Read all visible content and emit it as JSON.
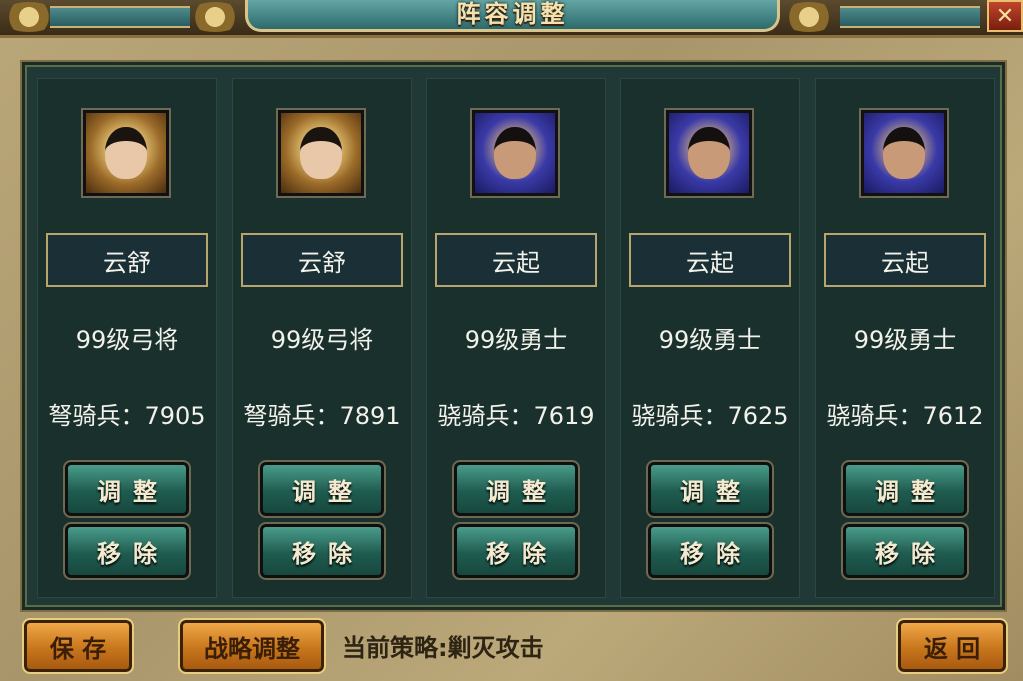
{
  "header": {
    "title": "阵容调整",
    "close_label": "✕"
  },
  "members": [
    {
      "portrait": "female-general-portrait",
      "name": "云舒",
      "level_class": "99级弓将",
      "troops": "弩骑兵：7905"
    },
    {
      "portrait": "female-general-portrait",
      "name": "云舒",
      "level_class": "99级弓将",
      "troops": "弩骑兵：7891"
    },
    {
      "portrait": "male-warrior-portrait",
      "name": "云起",
      "level_class": "99级勇士",
      "troops": "骁骑兵：7619"
    },
    {
      "portrait": "male-warrior-portrait",
      "name": "云起",
      "level_class": "99级勇士",
      "troops": "骁骑兵：7625"
    },
    {
      "portrait": "male-warrior-portrait",
      "name": "云起",
      "level_class": "99级勇士",
      "troops": "骁骑兵：7612"
    }
  ],
  "card_buttons": {
    "adjust": "调整",
    "remove": "移除"
  },
  "footer": {
    "save": "保 存",
    "strategy_adjust": "战略调整",
    "strategy_current": "当前策略:剿灭攻击",
    "back": "返 回"
  },
  "colors": {
    "parchment": "#b9a678",
    "panel": "#203936",
    "teal_button": "#1f5c50",
    "orange_button": "#c8761c",
    "text": "#f2f2ea"
  }
}
